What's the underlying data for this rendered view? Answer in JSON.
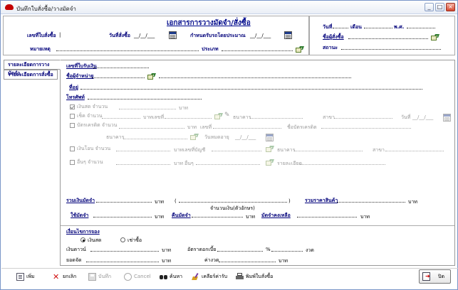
{
  "window": {
    "title": "บันทึกใบสั่งซื้อ/วางมัดจำ"
  },
  "header": {
    "doc_title": "เอกสารการวางมัดจำ/สั่งซื้อ",
    "order_no_label": "เลขที่ใบสั่งซื้อ",
    "order_date_label": "วันที่สั่งซื้อ",
    "order_date_value": "__/__/___",
    "delivery_label": "กำหนดรับรถโดยประมาณ",
    "delivery_value": "__/__/___",
    "note_label": "หมายเหตุ",
    "type_label": "ประเภท",
    "day_label": "วันที่",
    "month_label": "เดือน",
    "year_label": "พ.ศ.",
    "buyer_label": "ชื่อผู้สั่งซื้อ",
    "place_label": "สถานะ"
  },
  "tabs": [
    {
      "label": "รายละเอียดการวางมัดจำ"
    },
    {
      "label": "รายละเอียดการสั่งซื้อ"
    }
  ],
  "deposit": {
    "receipt_no_label": "เลขที่ใบรับเงิน",
    "payer_label": "ชื่อผู้จำหน่าย",
    "address_label": "ที่อยู่",
    "phone_label": "โทรศัพท์",
    "cash_label": "เงินสด จำนวน",
    "baht": "บาท",
    "cheque_label": "เช็ค จำนวน",
    "no_label": "เลขที่",
    "bank_label": "ธนาคาร",
    "branch_label": "สาขา",
    "date_label": "วันที่",
    "date_value": "__/__/___",
    "credit_label": "บัตรเครดิต จำนวน",
    "card_name_label": "ชื่อบัตรเครดิต",
    "expire_label": "วันหมดอายุ",
    "expire_value": "__/__/___",
    "transfer_label": "เงินโอน จำนวน",
    "account_label": "เลขที่บัญชี",
    "other_label": "อื่นๆ จำนวน",
    "other2_label": "อื่นๆ",
    "detail_label": "รายละเอียด",
    "total_label": "รวมเงินมัดจำ",
    "total_text_open": "(",
    "total_text_close": ")",
    "total_text_caption": "จำนวนเงิน(ตัวอักษร)",
    "car_price_label": "รวมราคาสินค้า",
    "used_label": "ใช้มัดจำ",
    "refund_label": "คืนมัดจำ",
    "balance_label": "มัดจำคงเหลือ"
  },
  "payment": {
    "title": "เงื่อนไขการจอง",
    "cash_option": "เงินสด",
    "leasing_option": "เช่าซื้อ",
    "down_label": "เงินดาวน์",
    "interest_label": "อัตราดอกเบี้ย",
    "percent": "%",
    "period_label": "งวด",
    "finance_label": "ยอดจัด",
    "installment_label": "ค่างวด",
    "baht": "บาท"
  },
  "toolbar": {
    "add": "เพิ่ม",
    "cancel_doc": "ยกเลิก",
    "save": "บันทึก",
    "cancel": "Cancel",
    "search": "ค้นหา",
    "clear": "เคลียร์ค่ารับ",
    "print": "พิมพ์ใบสั่งซื้อ",
    "exit": "ปิด"
  }
}
